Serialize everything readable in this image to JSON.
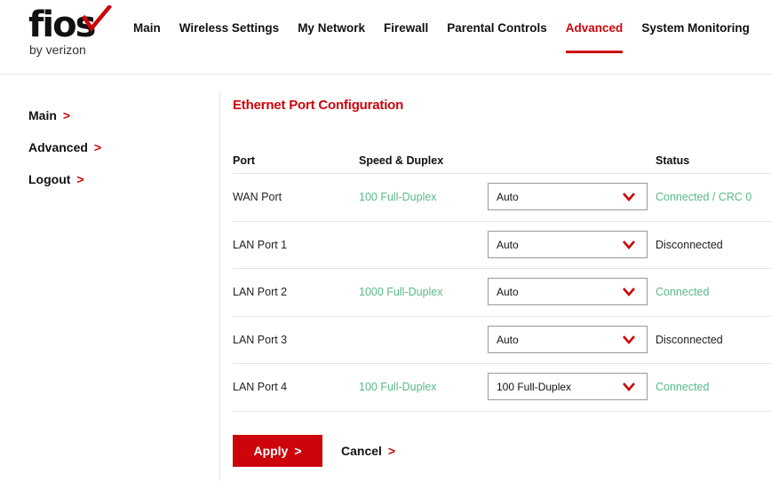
{
  "brand": {
    "logo_text": "fios",
    "logo_sub": "by verizon",
    "accent_color": "#cd040b",
    "ok_color": "#58b987"
  },
  "nav": {
    "items": [
      {
        "label": "Main"
      },
      {
        "label": "Wireless Settings"
      },
      {
        "label": "My Network"
      },
      {
        "label": "Firewall"
      },
      {
        "label": "Parental Controls"
      },
      {
        "label": "Advanced",
        "active": true
      },
      {
        "label": "System Monitoring"
      }
    ]
  },
  "sidebar": {
    "items": [
      {
        "label": "Main",
        "icon": "chevron-right-icon"
      },
      {
        "label": "Advanced",
        "icon": "chevron-right-icon"
      },
      {
        "label": "Logout",
        "icon": "chevron-right-icon"
      }
    ]
  },
  "main": {
    "title": "Ethernet Port Configuration",
    "table": {
      "headers": {
        "port": "Port",
        "speed": "Speed & Duplex",
        "status": "Status"
      },
      "rows": [
        {
          "port": "WAN Port",
          "speed": "100 Full-Duplex",
          "setting": "Auto",
          "status": "Connected / CRC 0",
          "status_type": "connected"
        },
        {
          "port": "LAN Port 1",
          "speed": "",
          "setting": "Auto",
          "status": "Disconnected",
          "status_type": "disconnected"
        },
        {
          "port": "LAN Port 2",
          "speed": "1000 Full-Duplex",
          "setting": "Auto",
          "status": "Connected",
          "status_type": "connected"
        },
        {
          "port": "LAN Port 3",
          "speed": "",
          "setting": "Auto",
          "status": "Disconnected",
          "status_type": "disconnected"
        },
        {
          "port": "LAN Port 4",
          "speed": "100 Full-Duplex",
          "setting": "100 Full-Duplex",
          "status": "Connected",
          "status_type": "connected"
        }
      ]
    },
    "apply_label": "Apply",
    "cancel_label": "Cancel"
  }
}
